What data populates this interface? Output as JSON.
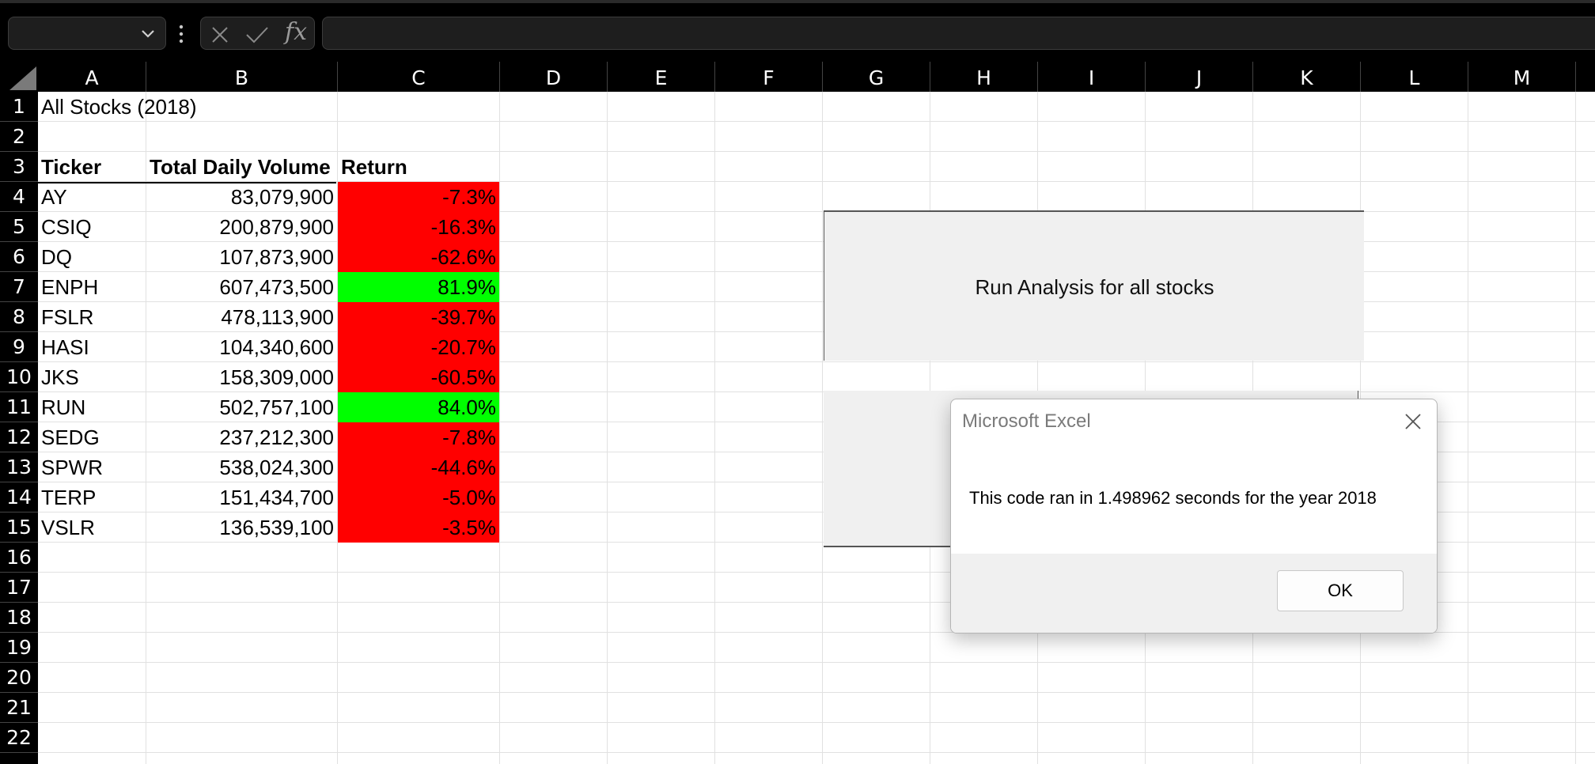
{
  "toolbar": {
    "name_box_value": "",
    "formula_value": "",
    "cancel_icon": "x-icon",
    "enter_icon": "checkmark-icon",
    "fx_label": "fx"
  },
  "columns": [
    "A",
    "B",
    "C",
    "D",
    "E",
    "F",
    "G",
    "H",
    "I",
    "J",
    "K",
    "L",
    "M"
  ],
  "rows": [
    "1",
    "2",
    "3",
    "4",
    "5",
    "6",
    "7",
    "8",
    "9",
    "10",
    "11",
    "12",
    "13",
    "14",
    "15",
    "16",
    "17",
    "18",
    "19",
    "20",
    "21",
    "22"
  ],
  "sheet": {
    "title": "All Stocks (2018)",
    "headers": {
      "ticker": "Ticker",
      "volume": "Total Daily Volume",
      "return": "Return"
    },
    "data": [
      {
        "ticker": "AY",
        "volume": "83,079,900",
        "return": "-7.3%"
      },
      {
        "ticker": "CSIQ",
        "volume": "200,879,900",
        "return": "-16.3%"
      },
      {
        "ticker": "DQ",
        "volume": "107,873,900",
        "return": "-62.6%"
      },
      {
        "ticker": "ENPH",
        "volume": "607,473,500",
        "return": "81.9%"
      },
      {
        "ticker": "FSLR",
        "volume": "478,113,900",
        "return": "-39.7%"
      },
      {
        "ticker": "HASI",
        "volume": "104,340,600",
        "return": "-20.7%"
      },
      {
        "ticker": "JKS",
        "volume": "158,309,000",
        "return": "-60.5%"
      },
      {
        "ticker": "RUN",
        "volume": "502,757,100",
        "return": "84.0%"
      },
      {
        "ticker": "SEDG",
        "volume": "237,212,300",
        "return": "-7.8%"
      },
      {
        "ticker": "SPWR",
        "volume": "538,024,300",
        "return": "-44.6%"
      },
      {
        "ticker": "TERP",
        "volume": "151,434,700",
        "return": "-5.0%"
      },
      {
        "ticker": "VSLR",
        "volume": "136,539,100",
        "return": "-3.5%"
      }
    ]
  },
  "colors": {
    "negative": "#ff0000",
    "positive": "#00ff00"
  },
  "buttons": {
    "run_all": "Run Analysis for all stocks"
  },
  "dialog": {
    "title": "Microsoft Excel",
    "message": "This code ran in 1.498962 seconds for the year 2018",
    "ok_label": "OK"
  }
}
